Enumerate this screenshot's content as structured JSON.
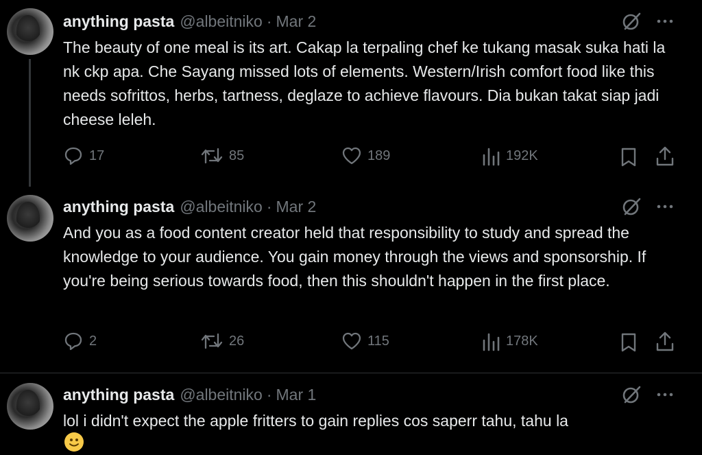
{
  "tweets": [
    {
      "name": "anything pasta",
      "handle": "@albeitniko",
      "separator": "·",
      "date": "Mar 2",
      "text": "The beauty of one meal is its art. Cakap la terpaling chef ke tukang masak suka hati la nk ckp apa. Che Sayang missed lots of elements. Western/Irish comfort food like this needs sofrittos, herbs, tartness, deglaze to achieve flavours. Dia bukan takat siap jadi cheese leleh.",
      "replies": "17",
      "reposts": "85",
      "likes": "189",
      "views": "192K"
    },
    {
      "name": "anything pasta",
      "handle": "@albeitniko",
      "separator": "·",
      "date": "Mar 2",
      "text": "And you as a food content creator held that responsibility to study and spread the knowledge to your audience. You gain money through the views and sponsorship. If you're being serious towards food, then this shouldn't happen in the first place.",
      "replies": "2",
      "reposts": "26",
      "likes": "115",
      "views": "178K"
    },
    {
      "name": "anything pasta",
      "handle": "@albeitniko",
      "separator": "·",
      "date": "Mar 1",
      "text": "lol i didn't expect the apple fritters to gain replies cos saperr tahu, tahu la",
      "emoji": "slightly-smiling-face"
    }
  ],
  "icons": {
    "reply": "reply-icon",
    "repost": "repost-icon",
    "like": "heart-icon",
    "views": "views-icon",
    "bookmark": "bookmark-icon",
    "share": "share-icon",
    "grok": "grok-icon",
    "more": "more-icon"
  },
  "colors": {
    "background": "#000000",
    "text": "#e7e9ea",
    "muted": "#71767b",
    "divider": "#2f3336"
  }
}
